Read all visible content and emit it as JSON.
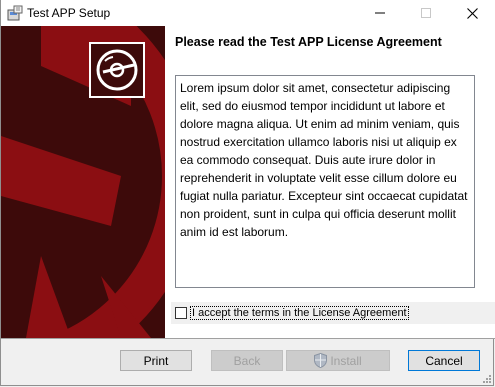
{
  "window": {
    "title": "Test APP Setup"
  },
  "content": {
    "heading": "Please read the Test APP License Agreement",
    "license_text": "Lorem ipsum dolor sit amet, consectetur adipiscing elit, sed do eiusmod tempor incididunt ut labore et dolore magna aliqua. Ut enim ad minim veniam, quis nostrud exercitation ullamco laboris nisi ut aliquip ex ea commodo consequat. Duis aute irure dolor in reprehenderit in voluptate velit esse cillum dolore eu fugiat nulla pariatur. Excepteur sint occaecat cupidatat non proident, sunt in culpa qui officia deserunt mollit anim id est laborum.",
    "accept_label": "I accept the terms in the License Agreement",
    "accept_checked": false
  },
  "buttons": {
    "print": "Print",
    "back": "Back",
    "install": "Install",
    "cancel": "Cancel"
  },
  "colors": {
    "banner_dark": "#3d0a0a",
    "banner_red": "#8b0e12",
    "accent": "#0078d7"
  },
  "icons": [
    "installer-icon",
    "minimize-icon",
    "maximize-icon",
    "close-icon",
    "disc-icon",
    "anchor-graphic",
    "uac-shield-icon",
    "resize-grip-icon"
  ]
}
